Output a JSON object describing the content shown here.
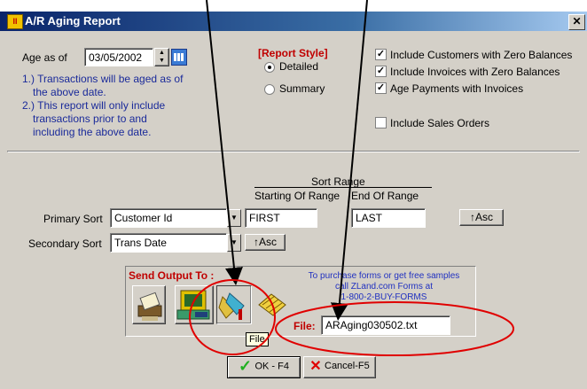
{
  "window": {
    "title": "A/R Aging Report",
    "close": "✕"
  },
  "age_as_of": {
    "label": "Age as of",
    "date": "03/05/2002",
    "note1a": "1.) Transactions will be aged as of",
    "note1b": "the above date.",
    "note2a": "2.) This report will only include",
    "note2b": "transactions prior to and",
    "note2c": "including the above date."
  },
  "report_style": {
    "title": "[Report Style]",
    "detailed": "Detailed",
    "summary": "Summary",
    "selected": "Detailed"
  },
  "options": {
    "zero_customers": "Include Customers with Zero Balances",
    "zero_invoices": "Include Invoices with Zero Balances",
    "age_payments": "Age Payments with Invoices",
    "sales_orders": "Include Sales Orders",
    "zero_customers_checked": true,
    "zero_invoices_checked": true,
    "age_payments_checked": true,
    "sales_orders_checked": false,
    "check_glyph": "✓"
  },
  "sort": {
    "range_title": "Sort Range",
    "start_header": "Starting Of Range",
    "end_header": "End Of Range",
    "primary_label": "Primary Sort",
    "primary_value": "Customer Id",
    "primary_start": "FIRST",
    "primary_end": "LAST",
    "primary_order": "↑Asc",
    "secondary_label": "Secondary Sort",
    "secondary_value": "Trans Date",
    "secondary_order": "↑Asc"
  },
  "output": {
    "title": "Send Output To :",
    "promo1": "To purchase forms or get free samples",
    "promo2": "call ZLand.com Forms at",
    "promo3": "1-800-2-BUY-FORMS",
    "file_label": "File:",
    "file_value": "ARAging030502.txt",
    "tooltip": "File",
    "icons": [
      "printer-icon",
      "screen-icon",
      "file-icon",
      "fax-icon"
    ],
    "selected": "file-icon"
  },
  "buttons": {
    "ok": "OK - F4",
    "cancel": "Cancel-F5"
  },
  "colors": {
    "title_gradient_start": "#0a246a",
    "dialog_bg": "#d4d0c8",
    "red_annotation": "#e00000",
    "blue_text": "#1a2a9a"
  }
}
